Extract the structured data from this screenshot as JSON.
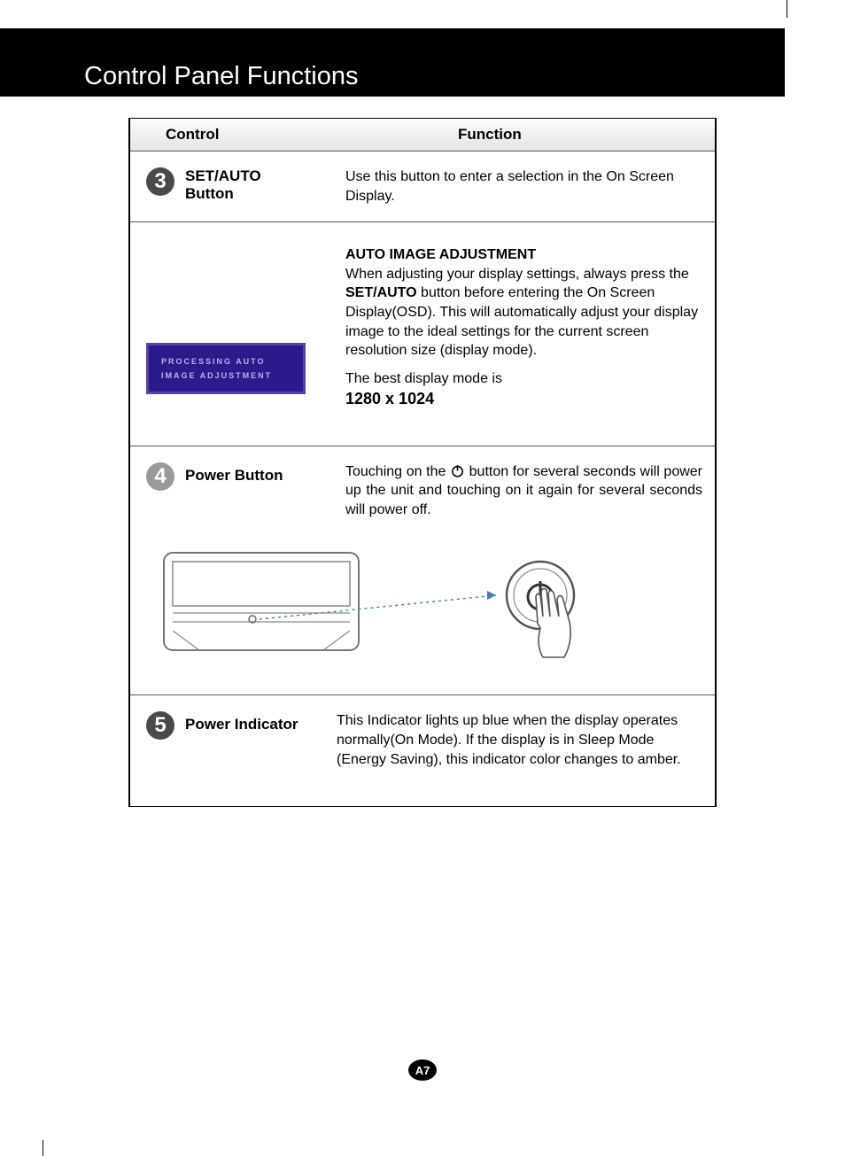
{
  "title": "Control Panel Functions",
  "headers": {
    "control": "Control",
    "function": "Function"
  },
  "row3": {
    "num": "3",
    "label_l1": "SET/AUTO",
    "label_l2": "Button",
    "desc": "Use this button to enter a selection in the On Screen Display.",
    "sub_title": "AUTO IMAGE ADJUSTMENT",
    "sub_body_a": "When adjusting your display settings, always press the ",
    "sub_bold": "SET/AUTO",
    "sub_body_b": " button before entering the On Screen Display(OSD). This will automatically adjust your display image to the ideal settings for the current screen resolution size (display mode).",
    "best_mode_label": "The best display mode is",
    "best_mode_value": "1280 x 1024",
    "osd_l1": "PROCESSING AUTO",
    "osd_l2": "IMAGE ADJUSTMENT"
  },
  "row4": {
    "num": "4",
    "label": "Power Button",
    "desc_a": "Touching on the ",
    "desc_b": " button for several seconds will power up the unit and touching on it again for several seconds will power off."
  },
  "row5": {
    "num": "5",
    "label": "Power Indicator",
    "desc": "This Indicator lights up blue when the display operates normally(On Mode). If the display is in Sleep Mode (Energy Saving), this indicator color changes to amber."
  },
  "page_num": "A7"
}
